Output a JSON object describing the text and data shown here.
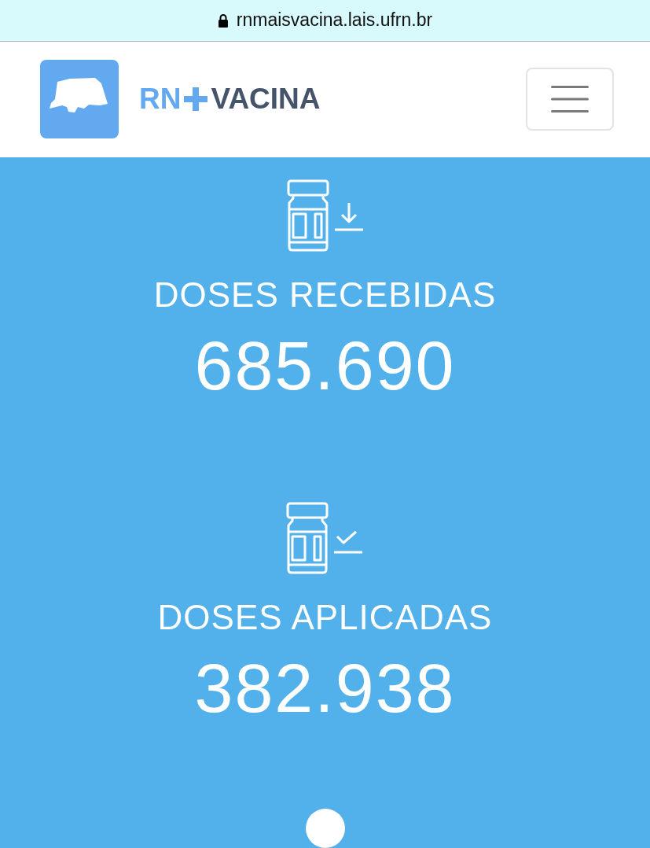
{
  "address_bar": {
    "url": "rnmaisvacina.lais.ufrn.br",
    "secure": true
  },
  "header": {
    "brand": {
      "first": "RN",
      "second": "VACINA"
    }
  },
  "stats": [
    {
      "kind": "received",
      "label": "DOSES RECEBIDAS",
      "value": "685.690"
    },
    {
      "kind": "applied",
      "label": "DOSES APLICADAS",
      "value": "382.938"
    }
  ]
}
